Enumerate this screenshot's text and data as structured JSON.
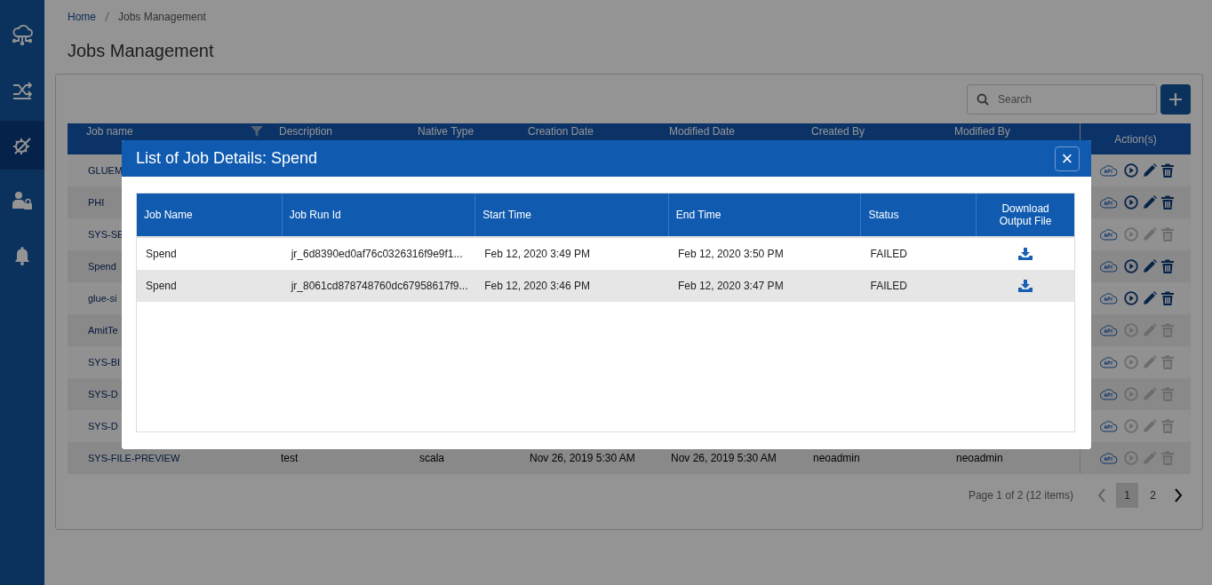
{
  "sidebar": {
    "items": [
      {
        "selected": false
      },
      {
        "selected": false
      },
      {
        "selected": true
      },
      {
        "selected": false
      },
      {
        "selected": false
      }
    ]
  },
  "breadcrumb": [
    "Home",
    "Jobs Management"
  ],
  "title": "Jobs Management",
  "search": {
    "placeholder": "Search"
  },
  "table": {
    "columns": [
      "Job name",
      "Description",
      "Native Type",
      "Creation Date",
      "Modified Date",
      "Created By",
      "Modified By",
      "Action(s)"
    ],
    "rows": [
      {
        "cells": [
          "GLUEM"
        ],
        "actions_enabled": true
      },
      {
        "cells": [
          "PHI"
        ],
        "actions_enabled": true
      },
      {
        "cells": [
          "SYS-SE"
        ],
        "actions_enabled": false
      },
      {
        "cells": [
          "Spend"
        ],
        "actions_enabled": true
      },
      {
        "cells": [
          "glue-si"
        ],
        "actions_enabled": true
      },
      {
        "cells": [
          "AmitTe"
        ],
        "actions_enabled": false
      },
      {
        "cells": [
          "SYS-BI"
        ],
        "actions_enabled": false
      },
      {
        "cells": [
          "SYS-D"
        ],
        "actions_enabled": false
      },
      {
        "cells": [
          "SYS-D"
        ],
        "actions_enabled": false
      },
      {
        "cells": [
          "SYS-FILE-PREVIEW",
          "test",
          "scala",
          "Nov 26, 2019 5:30 AM",
          "Nov 26, 2019 5:30 AM",
          "neoadmin",
          "neoadmin"
        ],
        "actions_enabled": false
      }
    ]
  },
  "pagination": {
    "summary": "Page 1 of 2 (12 items)",
    "prev_disabled": true,
    "pages": [
      {
        "label": "1",
        "selected": true
      },
      {
        "label": "2",
        "selected": false
      }
    ]
  },
  "modal": {
    "title": "List of Job Details: Spend",
    "close": "×",
    "columns": [
      "Job Name",
      "Job Run Id",
      "Start Time",
      "End Time",
      "Status",
      "Download Output File"
    ],
    "rows": [
      {
        "cells": [
          "Spend",
          "jr_6d8390ed0af76c0326316f9e9f1...",
          "Feb 12, 2020 3:49 PM",
          "Feb 12, 2020 3:50 PM",
          "FAILED"
        ]
      },
      {
        "cells": [
          "Spend",
          "jr_8061cd878748760dc67958617f9...",
          "Feb 12, 2020 3:46 PM",
          "Feb 12, 2020 3:47 PM",
          "FAILED"
        ]
      }
    ]
  }
}
